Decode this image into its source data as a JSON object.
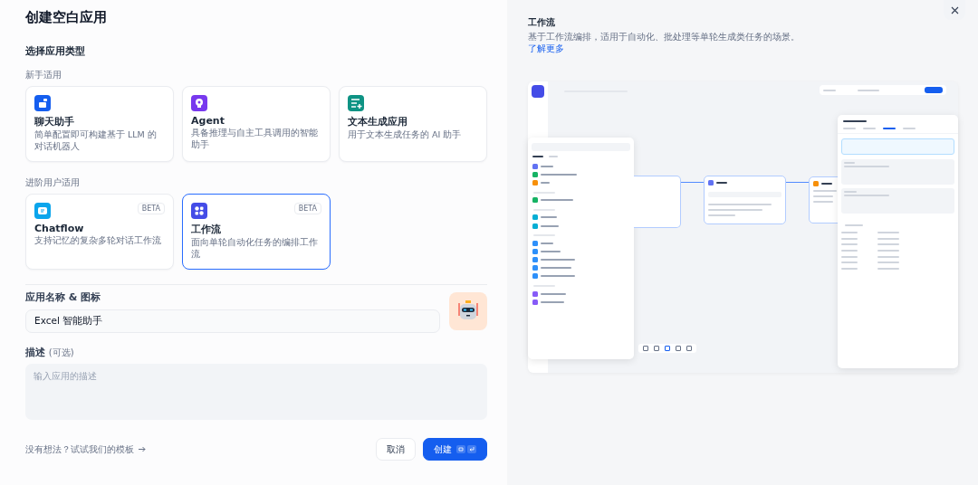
{
  "title": "创建空白应用",
  "type_heading": "选择应用类型",
  "groups": [
    {
      "label": "新手适用",
      "apps": [
        {
          "name": "聊天助手",
          "desc": "简单配置即可构建基于 LLM 的对话机器人",
          "kind": "chat",
          "selected": false
        },
        {
          "name": "Agent",
          "desc": "具备推理与自主工具调用的智能助手",
          "kind": "agent",
          "selected": false
        },
        {
          "name": "文本生成应用",
          "desc": "用于文本生成任务的 AI 助手",
          "kind": "text",
          "selected": false
        }
      ]
    },
    {
      "label": "进阶用户适用",
      "apps": [
        {
          "name": "Chatflow",
          "desc": "支持记忆的复杂多轮对话工作流",
          "kind": "chatflow",
          "badge": "BETA",
          "selected": false
        },
        {
          "name": "工作流",
          "desc": "面向单轮自动化任务的编排工作流",
          "kind": "workflow",
          "badge": "BETA",
          "selected": true
        }
      ]
    }
  ],
  "name_field": {
    "label": "应用名称 & 图标",
    "value": "Excel 智能助手"
  },
  "description_field": {
    "label": "描述",
    "optional": "(可选)",
    "placeholder": "输入应用的描述"
  },
  "footer": {
    "template_link": "没有想法？试试我们的模板",
    "buttons": [
      {
        "label": "取消",
        "kind": "secondary"
      },
      {
        "label": "创建",
        "kind": "primary"
      }
    ]
  },
  "preview": {
    "title": "工作流",
    "description": "基于工作流编排，适用于自动化、批处理等单轮生成类任务的场景。",
    "link": "了解更多"
  }
}
